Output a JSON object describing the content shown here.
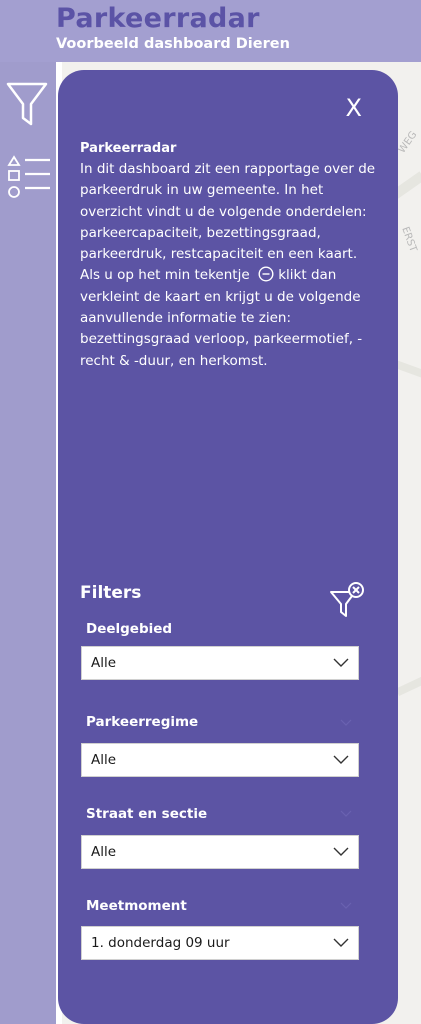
{
  "header": {
    "title": "Parkeerradar",
    "subtitle": "Voorbeeld dashboard Dieren"
  },
  "rail": {
    "filter_icon": "filter-icon",
    "legend_icon": "legend-list-icon"
  },
  "map": {
    "road_labels": [
      "WEG",
      "ERST"
    ]
  },
  "panel": {
    "close_label": "X",
    "info_title": "Parkeerradar",
    "info_text_1": "In dit dashboard zit een rapportage over de parkeerdruk in uw gemeente. In het overzicht vindt u de volgende onderdelen: parkeercapaciteit, bezettingsgraad, parkeerdruk, restcapaciteit en een kaart. Als u op het min tekentje",
    "info_text_2": "klikt dan verkleint de kaart en krijgt u de volgende aanvullende informatie te zien: bezettingsgraad verloop, parkeermotief, -recht & -duur, en herkomst.",
    "filters_heading": "Filters",
    "clear_filters_icon": "clear-filter-icon",
    "filters": [
      {
        "label": "Deelgebied",
        "value": "Alle"
      },
      {
        "label": "Parkeerregime",
        "value": "Alle"
      },
      {
        "label": "Straat en sectie",
        "value": "Alle"
      },
      {
        "label": "Meetmoment",
        "value": "1. donderdag 09 uur"
      }
    ]
  },
  "colors": {
    "panel": "#5c54a4",
    "header_bg": "#a39fd0",
    "title": "#5b53a6",
    "rail_bg": "#a09ccc"
  }
}
